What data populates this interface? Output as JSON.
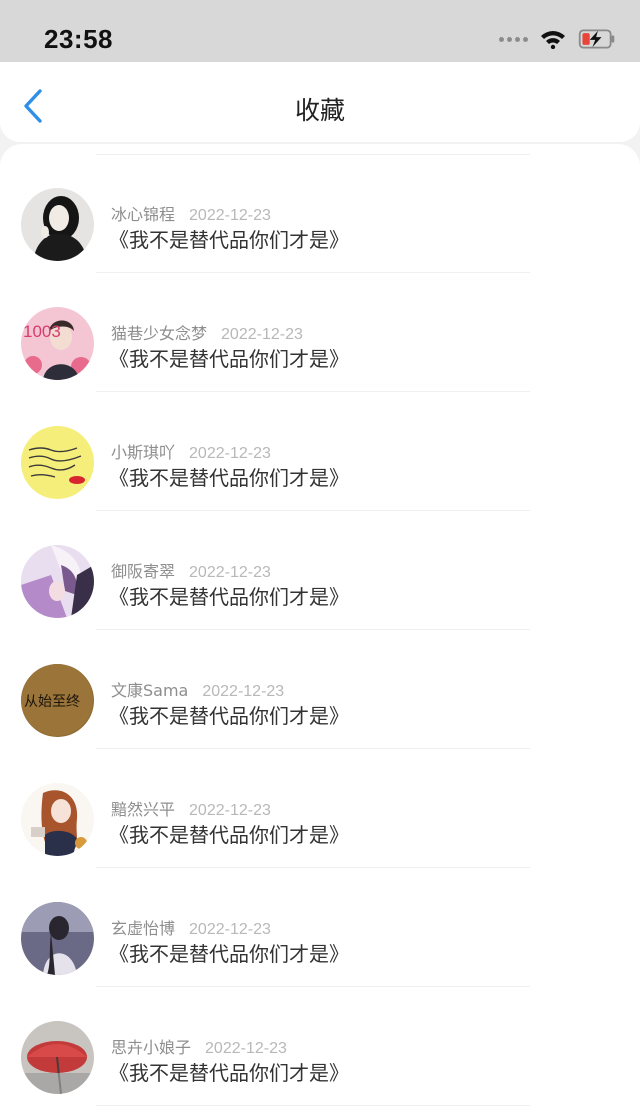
{
  "status_bar": {
    "time": "23:58",
    "icons": [
      "signal-dots-icon",
      "wifi-icon",
      "battery-charging-icon"
    ]
  },
  "header": {
    "title": "收藏",
    "back_icon": "chevron-left-icon"
  },
  "colors": {
    "accent": "#2f8fe6",
    "battery_low": "#e8443a",
    "status_bg": "#d8d8d8"
  },
  "favorites": [
    {
      "user": "冰心锦程",
      "date": "2022-12-23",
      "book": "《我不是替代品你们才是》"
    },
    {
      "user": "猫巷少女念梦",
      "date": "2022-12-23",
      "book": "《我不是替代品你们才是》"
    },
    {
      "user": "小斯琪吖",
      "date": "2022-12-23",
      "book": "《我不是替代品你们才是》"
    },
    {
      "user": "御阪寄翠",
      "date": "2022-12-23",
      "book": "《我不是替代品你们才是》"
    },
    {
      "user": "文康Sama",
      "date": "2022-12-23",
      "book": "《我不是替代品你们才是》"
    },
    {
      "user": "黯然兴平",
      "date": "2022-12-23",
      "book": "《我不是替代品你们才是》"
    },
    {
      "user": "玄虚怡博",
      "date": "2022-12-23",
      "book": "《我不是替代品你们才是》"
    },
    {
      "user": "思卉小娘子",
      "date": "2022-12-23",
      "book": "《我不是替代品你们才是》"
    }
  ],
  "avatar_texts": {
    "avatar_2": "1003",
    "avatar_5": "从始至终"
  }
}
